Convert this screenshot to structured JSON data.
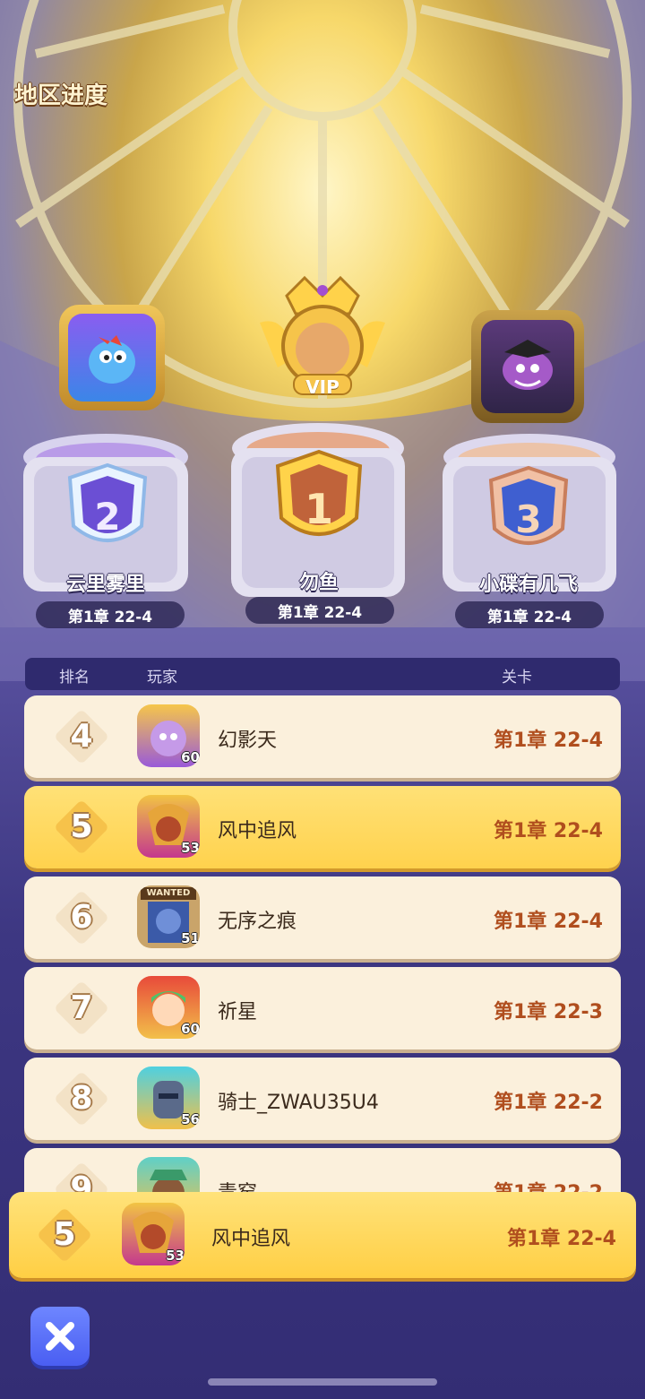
{
  "title": "地区进度",
  "podium": [
    {
      "rank": "2",
      "name": "云里雾里",
      "stage": "第1章 22-4"
    },
    {
      "rank": "1",
      "name": "勿鱼",
      "stage": "第1章 22-4",
      "badge": "VIP"
    },
    {
      "rank": "3",
      "name": "小碟有几飞",
      "stage": "第1章 22-4"
    }
  ],
  "table_header": {
    "rank": "排名",
    "player": "玩家",
    "level": "关卡"
  },
  "rows": [
    {
      "rank": "4",
      "name": "幻影天",
      "level": "60",
      "stage": "第1章 22-4"
    },
    {
      "rank": "5",
      "name": "风中追风",
      "level": "53",
      "stage": "第1章 22-4"
    },
    {
      "rank": "6",
      "name": "无序之痕",
      "level": "51",
      "stage": "第1章 22-4",
      "avatar_tag": "WANTED"
    },
    {
      "rank": "7",
      "name": "祈星",
      "level": "60",
      "stage": "第1章 22-3"
    },
    {
      "rank": "8",
      "name": "骑士_ZWAU35U4",
      "level": "56",
      "stage": "第1章 22-2"
    },
    {
      "rank": "9",
      "name": "青窑",
      "level": "",
      "stage": "第1章 22-2"
    }
  ],
  "me": {
    "rank": "5",
    "name": "风中追风",
    "level": "53",
    "stage": "第1章 22-4"
  },
  "close_icon": "close-icon",
  "colors": {
    "highlight": "#ffd24d",
    "stage_text": "#b04e1e",
    "row_bg": "#fbf0dc",
    "close_button": "#5a6ef6"
  }
}
